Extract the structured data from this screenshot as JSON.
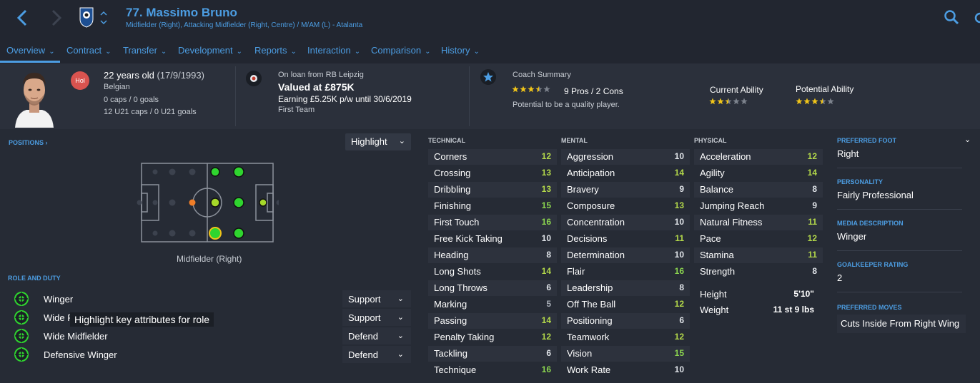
{
  "header": {
    "player_name": "77. Massimo Bruno",
    "player_subtitle": "Midfielder (Right), Attacking Midfielder (Right, Centre) / M/AM (L) - Atalanta"
  },
  "tabs": [
    {
      "label": "Overview"
    },
    {
      "label": "Contract"
    },
    {
      "label": "Transfer"
    },
    {
      "label": "Development"
    },
    {
      "label": "Reports"
    },
    {
      "label": "Interaction"
    },
    {
      "label": "Comparison"
    },
    {
      "label": "History"
    }
  ],
  "profile": {
    "badge": "Hol",
    "age": "22 years old",
    "dob": "(17/9/1993)",
    "nationality": "Belgian",
    "caps": "0 caps / 0 goals",
    "u21_caps": "12 U21 caps / 0 U21 goals"
  },
  "loan": {
    "label": "On loan from RB Leipzig",
    "value": "Valued at £875K",
    "earning": "Earning £5.25K p/w until 30/6/2019",
    "squad": "First Team"
  },
  "coach": {
    "label": "Coach Summary",
    "stars": 3.5,
    "pros_cons": "9 Pros / 2 Cons",
    "potential_text": "Potential to be a quality player.",
    "current_ability_label": "Current Ability",
    "current_ability_stars": 2.5,
    "potential_ability_label": "Potential Ability",
    "potential_ability_stars": 3.5
  },
  "positions": {
    "label": "POSITIONS ›",
    "highlight_label": "Highlight",
    "caption": "Midfielder (Right)"
  },
  "role_duty": {
    "label": "ROLE AND DUTY",
    "roles": [
      {
        "name": "Winger",
        "duty": "Support"
      },
      {
        "name": "Wide P",
        "duty": "Support"
      },
      {
        "name": "Wide Midfielder",
        "duty": "Defend"
      },
      {
        "name": "Defensive Winger",
        "duty": "Defend"
      }
    ],
    "tooltip": "Highlight key attributes for role"
  },
  "attributes": {
    "technical_label": "TECHNICAL",
    "mental_label": "MENTAL",
    "physical_label": "PHYSICAL",
    "technical": [
      {
        "name": "Corners",
        "value": "12"
      },
      {
        "name": "Crossing",
        "value": "13"
      },
      {
        "name": "Dribbling",
        "value": "13"
      },
      {
        "name": "Finishing",
        "value": "15"
      },
      {
        "name": "First Touch",
        "value": "16"
      },
      {
        "name": "Free Kick Taking",
        "value": "10"
      },
      {
        "name": "Heading",
        "value": "8"
      },
      {
        "name": "Long Shots",
        "value": "14"
      },
      {
        "name": "Long Throws",
        "value": "6"
      },
      {
        "name": "Marking",
        "value": "5"
      },
      {
        "name": "Passing",
        "value": "14"
      },
      {
        "name": "Penalty Taking",
        "value": "12"
      },
      {
        "name": "Tackling",
        "value": "6"
      },
      {
        "name": "Technique",
        "value": "16"
      }
    ],
    "mental": [
      {
        "name": "Aggression",
        "value": "10"
      },
      {
        "name": "Anticipation",
        "value": "14"
      },
      {
        "name": "Bravery",
        "value": "9"
      },
      {
        "name": "Composure",
        "value": "13"
      },
      {
        "name": "Concentration",
        "value": "10"
      },
      {
        "name": "Decisions",
        "value": "11"
      },
      {
        "name": "Determination",
        "value": "10"
      },
      {
        "name": "Flair",
        "value": "16"
      },
      {
        "name": "Leadership",
        "value": "8"
      },
      {
        "name": "Off The Ball",
        "value": "12"
      },
      {
        "name": "Positioning",
        "value": "6"
      },
      {
        "name": "Teamwork",
        "value": "12"
      },
      {
        "name": "Vision",
        "value": "15"
      },
      {
        "name": "Work Rate",
        "value": "10"
      }
    ],
    "physical": [
      {
        "name": "Acceleration",
        "value": "12"
      },
      {
        "name": "Agility",
        "value": "14"
      },
      {
        "name": "Balance",
        "value": "8"
      },
      {
        "name": "Jumping Reach",
        "value": "9"
      },
      {
        "name": "Natural Fitness",
        "value": "11"
      },
      {
        "name": "Pace",
        "value": "12"
      },
      {
        "name": "Stamina",
        "value": "11"
      },
      {
        "name": "Strength",
        "value": "8"
      }
    ],
    "height_label": "Height",
    "height": "5'10\"",
    "weight_label": "Weight",
    "weight": "11 st 9 lbs"
  },
  "details": {
    "foot_label": "PREFERRED FOOT",
    "foot": "Right",
    "personality_label": "PERSONALITY",
    "personality": "Fairly Professional",
    "media_label": "MEDIA DESCRIPTION",
    "media": "Winger",
    "gk_label": "GOALKEEPER RATING",
    "gk": "2",
    "moves_label": "PREFERRED MOVES",
    "move": "Cuts Inside From Right Wing"
  },
  "colors": {
    "accent": "#4c9de2",
    "star": "#f0c419",
    "high": "#8bd44f",
    "mid": "#b3d84a",
    "background": "#262b35"
  }
}
